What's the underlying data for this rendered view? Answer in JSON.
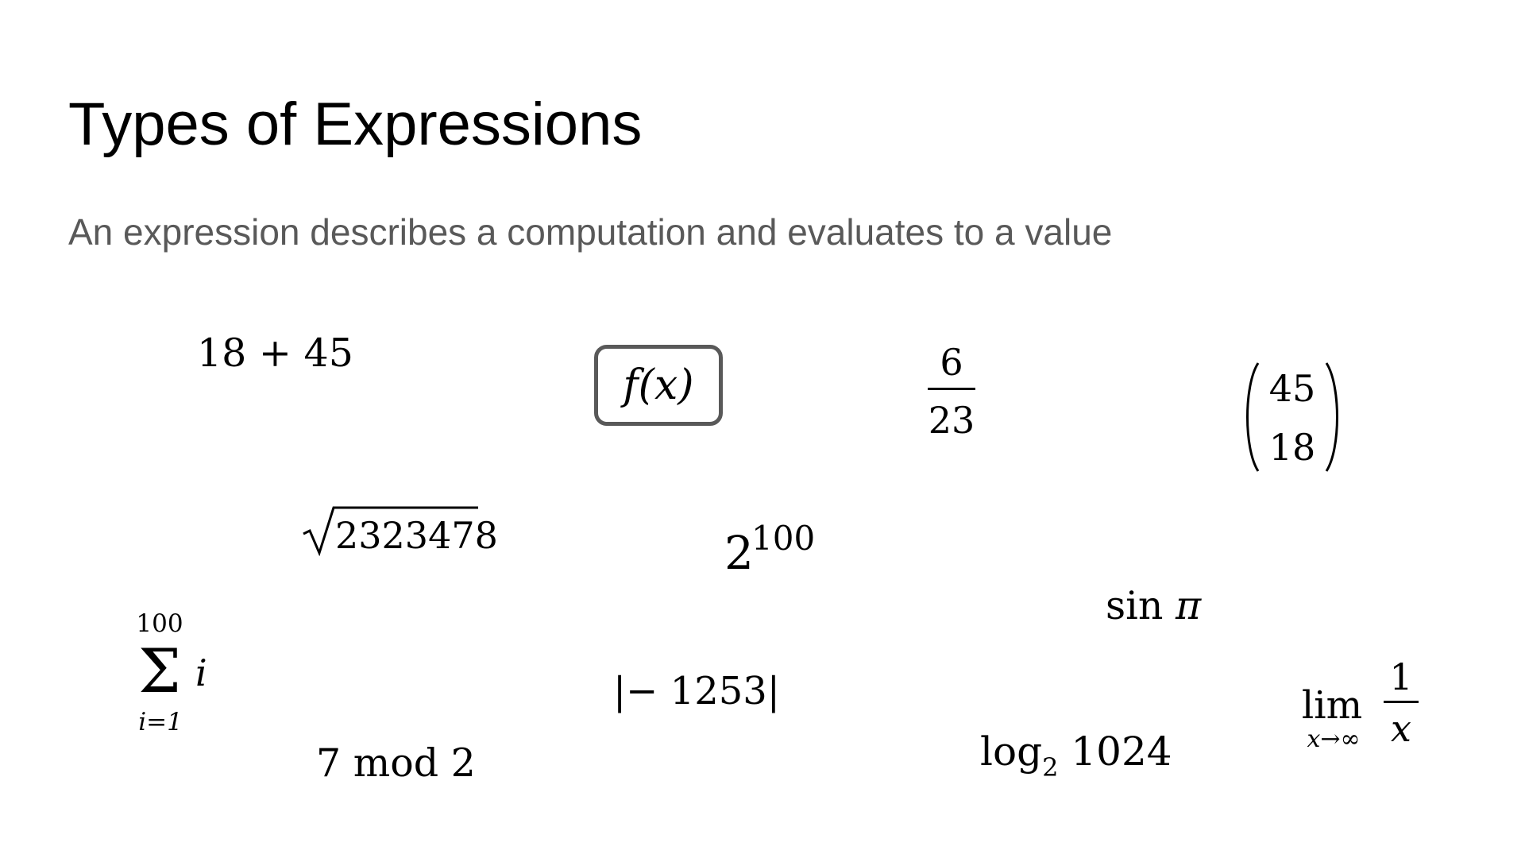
{
  "slide": {
    "title": "Types of Expressions",
    "subtitle": "An expression describes a computation and evaluates to a value"
  },
  "expressions": {
    "addition": "18 + 45",
    "function_call": "f(x)",
    "fraction": {
      "numerator": "6",
      "denominator": "23"
    },
    "binomial": {
      "top": "45",
      "bottom": "18"
    },
    "square_root": {
      "radicand": "2323478"
    },
    "power": {
      "base": "2",
      "exponent": "100"
    },
    "summation": {
      "upper": "100",
      "lower": "i=1",
      "body": "i"
    },
    "sine": {
      "function": "sin",
      "argument": "π"
    },
    "absolute_value": "|− 1253|",
    "modulo": "7 mod 2",
    "logarithm": {
      "function": "log",
      "base": "2",
      "argument": "1024"
    },
    "limit": {
      "word": "lim",
      "approach": "x→∞",
      "numerator": "1",
      "denominator": "x"
    }
  }
}
